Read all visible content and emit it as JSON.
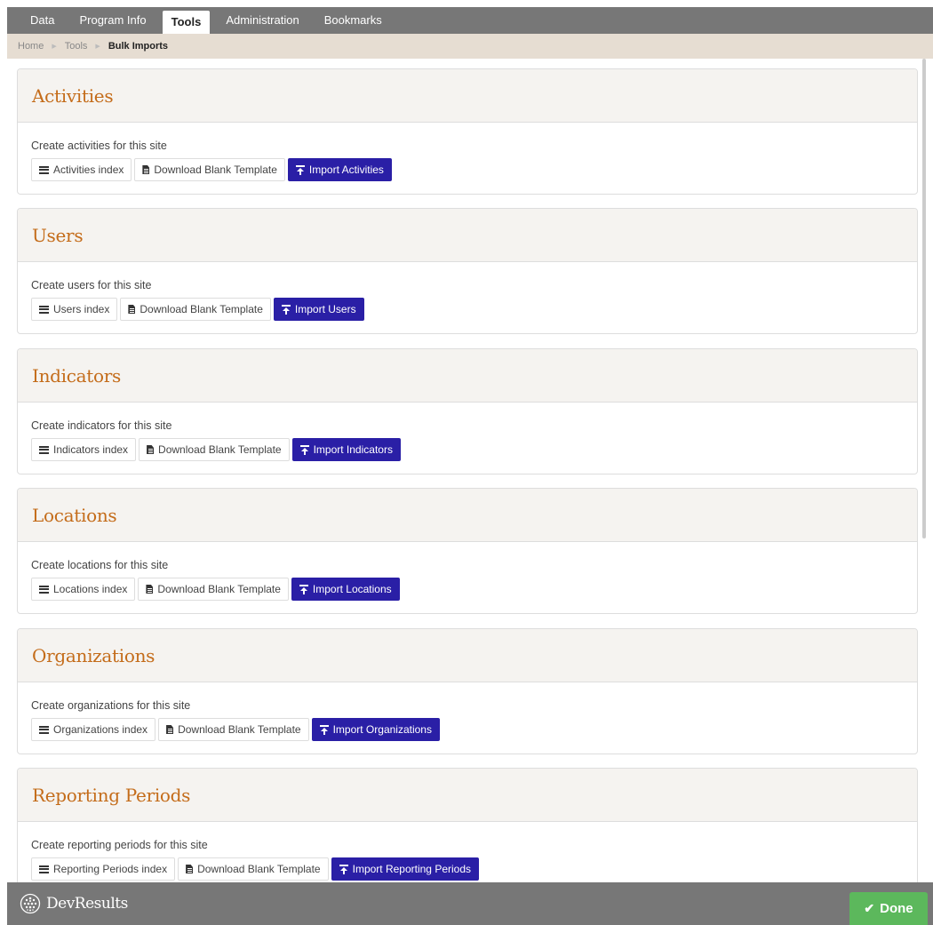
{
  "nav": {
    "tabs": [
      {
        "label": "Data"
      },
      {
        "label": "Program Info"
      },
      {
        "label": "Tools"
      },
      {
        "label": "Administration"
      },
      {
        "label": "Bookmarks"
      }
    ],
    "active_tab": "Tools"
  },
  "breadcrumb": {
    "items": [
      "Home",
      "Tools",
      "Bulk Imports"
    ]
  },
  "panels": [
    {
      "title": "Activities",
      "description": "Create activities for this site",
      "index_label": "Activities index",
      "template_label": "Download Blank Template",
      "import_label": "Import Activities"
    },
    {
      "title": "Users",
      "description": "Create users for this site",
      "index_label": "Users index",
      "template_label": "Download Blank Template",
      "import_label": "Import Users"
    },
    {
      "title": "Indicators",
      "description": "Create indicators for this site",
      "index_label": "Indicators index",
      "template_label": "Download Blank Template",
      "import_label": "Import Indicators"
    },
    {
      "title": "Locations",
      "description": "Create locations for this site",
      "index_label": "Locations index",
      "template_label": "Download Blank Template",
      "import_label": "Import Locations"
    },
    {
      "title": "Organizations",
      "description": "Create organizations for this site",
      "index_label": "Organizations index",
      "template_label": "Download Blank Template",
      "import_label": "Import Organizations"
    },
    {
      "title": "Reporting Periods",
      "description": "Create reporting periods for this site",
      "index_label": "Reporting Periods index",
      "template_label": "Download Blank Template",
      "import_label": "Import Reporting Periods"
    }
  ],
  "footer": {
    "brand": "DevResults",
    "done_label": "Done"
  },
  "colors": {
    "accent_primary": "#2a1fa6",
    "title_orange": "#c46c1a",
    "done_green": "#5cb85c",
    "chrome_gray": "#777777"
  }
}
